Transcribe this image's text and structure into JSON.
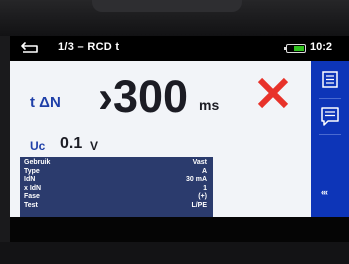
{
  "status_bar": {
    "title": "1/3 – RCD t",
    "time": "10:2",
    "battery_color": "#31c21f"
  },
  "measurement": {
    "label": "t ΔN",
    "value": "›300",
    "unit": "ms",
    "result_icon": "fail-x-icon",
    "result_color": "#e8322a"
  },
  "voltage": {
    "label": "Uc",
    "value": "0.1",
    "unit": "V"
  },
  "settings": [
    {
      "key": "Gebruik",
      "value": "Vast"
    },
    {
      "key": "Type",
      "value": "A"
    },
    {
      "key": "IdN",
      "value": "30 mA"
    },
    {
      "key": "x IdN",
      "value": "1"
    },
    {
      "key": "Fase",
      "value": "(+)"
    },
    {
      "key": "Test",
      "value": "L/PE"
    }
  ],
  "sidebar": {
    "buttons": [
      "list-icon",
      "memo-icon"
    ],
    "more_label": "‹‹‹",
    "color": "#0d35b8"
  }
}
